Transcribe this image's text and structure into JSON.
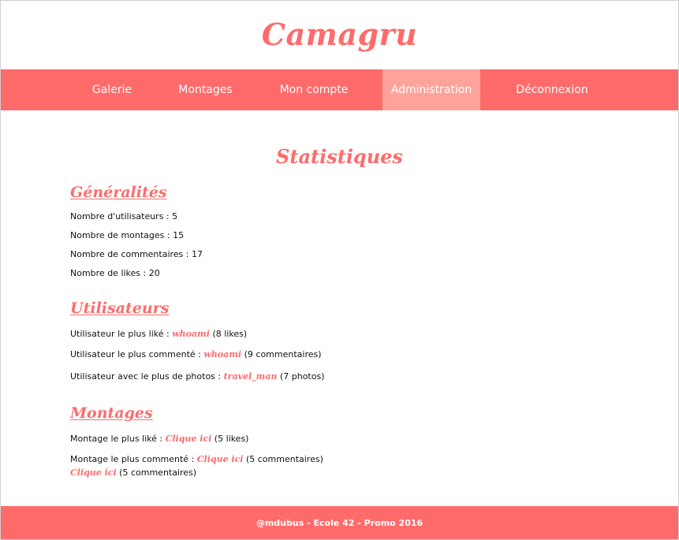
{
  "site": {
    "title": "Camagru"
  },
  "nav": {
    "galerie": "Galerie",
    "montages": "Montages",
    "mon_compte": "Mon compte",
    "administration": "Administration",
    "deconnexion": "Déconnexion",
    "active": "Administration"
  },
  "page": {
    "title": "Statistiques"
  },
  "generalites": {
    "title": "Généralités",
    "users_label": "Nombre d'utilisateurs : ",
    "users_value": "5",
    "montages_label": "Nombre de montages : ",
    "montages_value": "15",
    "comments_label": "Nombre de commentaires : ",
    "comments_value": "17",
    "likes_label": "Nombre de likes : ",
    "likes_value": "20"
  },
  "utilisateurs": {
    "title": "Utilisateurs",
    "most_liked_label": "Utilisateur le plus liké : ",
    "most_liked_user": "whoami",
    "most_liked_suffix": " (8 likes)",
    "most_commented_label": "Utilisateur le plus commenté : ",
    "most_commented_user": "whoami",
    "most_commented_suffix": " (9 commentaires)",
    "most_photos_label": "Utilisateur avec le plus de photos : ",
    "most_photos_user": "travel_man",
    "most_photos_suffix": " (7 photos)"
  },
  "montages_section": {
    "title": "Montages",
    "most_liked_label": "Montage le plus liké : ",
    "most_liked_link": "Clique ici",
    "most_liked_suffix": " (5 likes)",
    "most_commented_label": "Montage le plus commenté : ",
    "most_commented_link": "Clique ici",
    "most_commented_suffix": " (5 commentaires)",
    "extra_link": "Clique ici",
    "extra_suffix": " (5 commentaires)"
  },
  "footer": {
    "text": "@mdubus - Ecole 42 - Promo 2016"
  },
  "colors": {
    "accent": "#ff6b6b",
    "nav_active": "#ffa39a",
    "text": "#111111",
    "background": "#ffffff"
  }
}
